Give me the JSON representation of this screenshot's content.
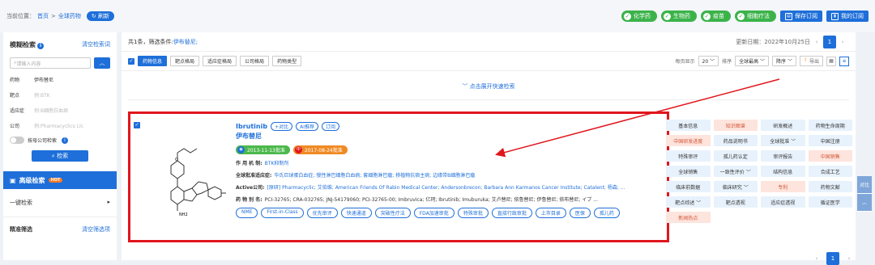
{
  "breadcrumb": {
    "label": "当前位置：",
    "home": "首页",
    "sep": ">",
    "current": "全球药物",
    "refresh": "刷新"
  },
  "top_filters": [
    "化学药",
    "生物药",
    "疫苗",
    "细胞疗法"
  ],
  "top_buttons": {
    "save": "保存订阅",
    "mine": "我的订阅"
  },
  "sidebar": {
    "title": "模糊检索",
    "clear": "清空检索词",
    "search_placeholder": "请输入内容",
    "fields": [
      {
        "k": "药物",
        "v": "伊布替尼",
        "filled": true
      },
      {
        "k": "靶点",
        "v": "例:BTK",
        "filled": false
      },
      {
        "k": "适应症",
        "v": "例:B细胞白血病",
        "filled": false
      },
      {
        "k": "公司",
        "v": "例:Pharmacyclics Llc",
        "filled": false
      }
    ],
    "toggle_label": "按母公司检索",
    "search_btn": "检索",
    "advanced": "高级检索",
    "hot": "HOT",
    "one_click": "一键检索",
    "precise": "精准筛选",
    "precise_clear": "清空筛选项"
  },
  "main": {
    "summary": "共1条，筛选条件:",
    "condition": "伊布替尼;",
    "updated": "更新日期：2022年10月25日",
    "page": "1",
    "tabs": [
      "药物信息",
      "靶点格局",
      "适应症格局",
      "公司格局",
      "药物类型"
    ],
    "per_page_label": "每页显示",
    "per_page": "20",
    "sort_label": "排序",
    "sort_field": "全球最高",
    "sort_order": "降序",
    "export": "导出",
    "expand": "点击展开快速检索"
  },
  "drug": {
    "name_en": "Ibrutinib",
    "compare": "+对比",
    "ai": "AI推荐",
    "subscribe": "订阅",
    "name_cn": "伊布替尼",
    "badge1": "2013-11-13批准",
    "badge2": "2017-08-24批准",
    "mech_label": "作 用 机 制:",
    "mech": "BTK抑制剂",
    "ind_label": "全球批准适应症:",
    "ind": "华氏巨球蛋白血症; 慢性淋巴细胞白血病; 套细胞淋巴瘤; 移植物抗宿主病; 边缘带B细胞淋巴瘤",
    "co_label": "Active公司:",
    "co": "[原研] Pharmacyclic; 艾伯维; American Friends Of Rabin Medical Center; Andersonbrecon; Barbara Ann Karmanos Cancer Institute; Catalent; 杨森; ...",
    "alias_label": "药 物 别 名:",
    "alias": "PCI-32765; CRA-032765; JNJ-54179060; PCI-32765-00; Imbruvica; 亿珂; Ibrutinib; Imuburuka; 艾卢替尼; 依鲁替尼; 伊鲁替尼; 依布替尼; イブ ...",
    "tags": [
      "NME",
      "First-in-Class",
      "优先审评",
      "快速通道",
      "突破性疗法",
      "FDA加速审批",
      "特殊审批",
      "直接行政审批",
      "上市目录",
      "医保",
      "孤儿药"
    ],
    "struct_label": "NH2"
  },
  "grid": [
    {
      "t": "基本信息",
      "p": false
    },
    {
      "t": "知识图谱",
      "p": true
    },
    {
      "t": "研发概述",
      "p": false
    },
    {
      "t": "药物生命周期",
      "p": false
    },
    {
      "t": "中国研发进度",
      "p": true
    },
    {
      "t": "药品说明书",
      "p": false
    },
    {
      "t": "全球批准 ﹀",
      "p": false
    },
    {
      "t": "中国注册",
      "p": false
    },
    {
      "t": "特殊审评",
      "p": false
    },
    {
      "t": "孤儿药认定",
      "p": false
    },
    {
      "t": "审评报告",
      "p": false
    },
    {
      "t": "中国销售",
      "p": true
    },
    {
      "t": "全球销售",
      "p": false
    },
    {
      "t": "一致性评价 ﹀",
      "p": false
    },
    {
      "t": "结构信息",
      "p": false
    },
    {
      "t": "合成工艺",
      "p": false
    },
    {
      "t": "临床前数据",
      "p": false
    },
    {
      "t": "临床研究 ﹀",
      "p": false
    },
    {
      "t": "专利",
      "p": true
    },
    {
      "t": "药物文献",
      "p": false
    },
    {
      "t": "靶点综述 ﹀",
      "p": false
    },
    {
      "t": "靶点透视",
      "p": false
    },
    {
      "t": "适应症透视",
      "p": false
    },
    {
      "t": "循证医学",
      "p": false
    },
    {
      "t": "新闻热点",
      "p": true
    }
  ],
  "floating": [
    "对比",
    "︿"
  ],
  "bottom_page": "1"
}
